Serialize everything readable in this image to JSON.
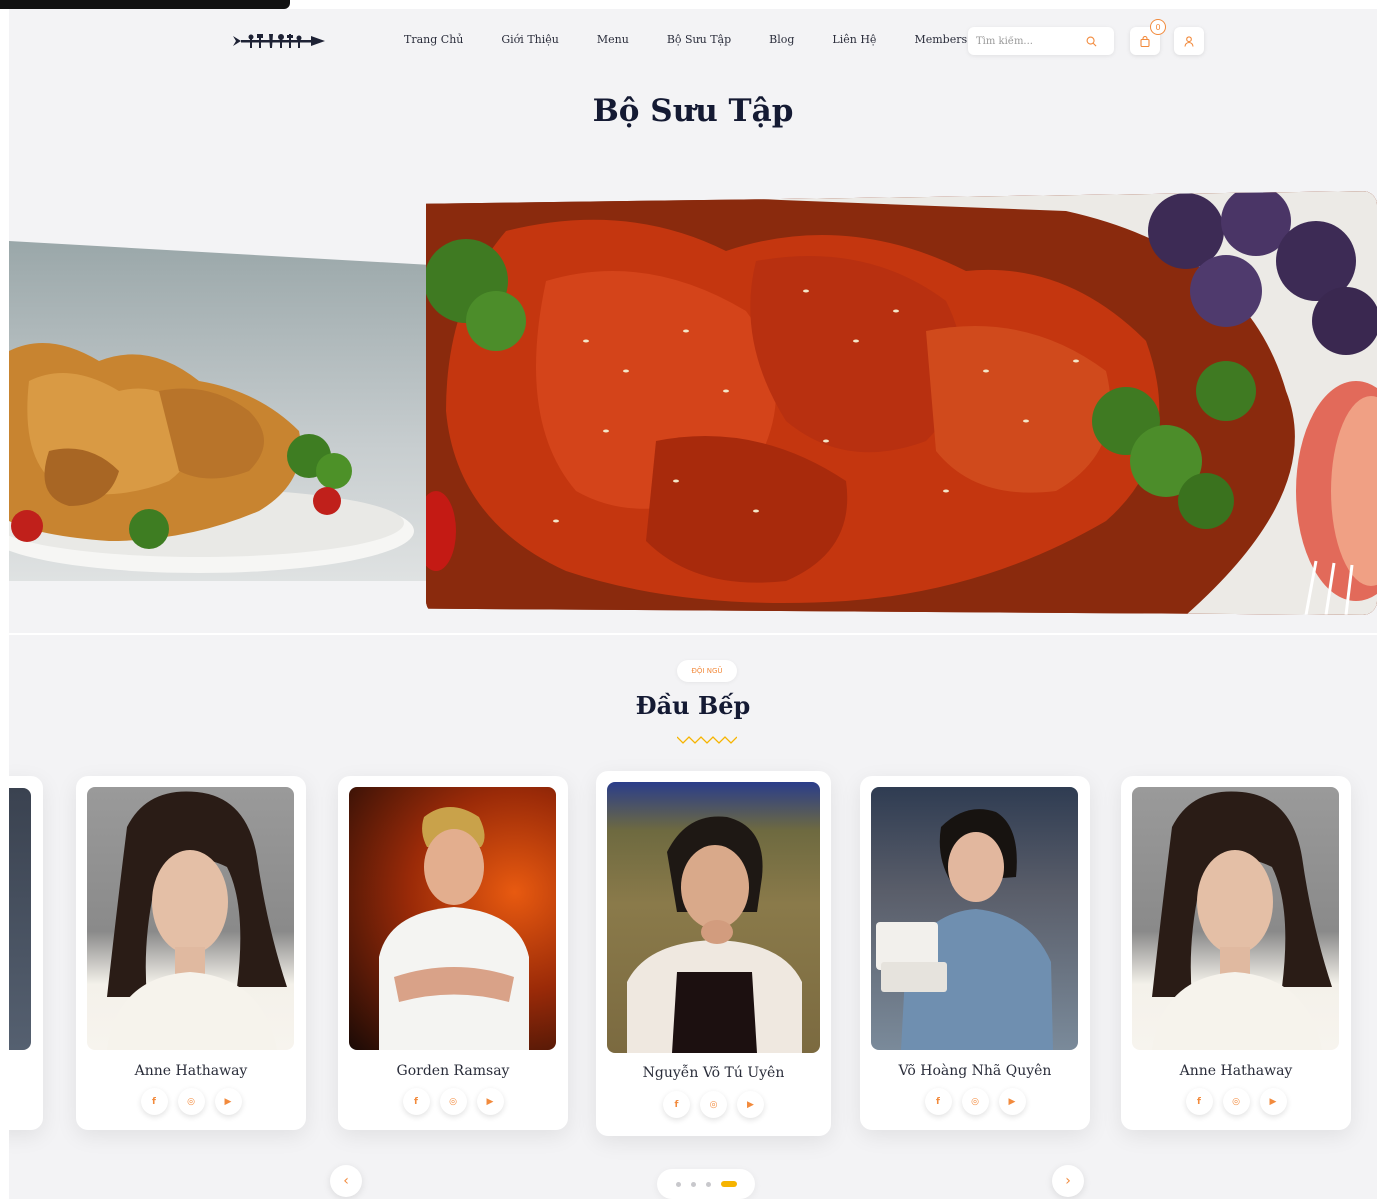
{
  "nav": {
    "items": [
      "Trang Chủ",
      "Giới Thiệu",
      "Menu",
      "Bộ Sưu Tập",
      "Blog",
      "Liên Hệ",
      "Members"
    ]
  },
  "search": {
    "placeholder": "Tìm kiếm..."
  },
  "cart": {
    "count": "0"
  },
  "page": {
    "title": "Bộ Sưu Tập"
  },
  "team": {
    "tag": "ĐỘI NGŨ",
    "title": "Đầu Bếp",
    "members": [
      {
        "name": "Anne Hathaway"
      },
      {
        "name": "Gorden Ramsay"
      },
      {
        "name": "Nguyễn Võ Tú Uyên"
      },
      {
        "name": "Võ Hoàng Nhã Quyên"
      },
      {
        "name": "Anne Hathaway"
      }
    ]
  },
  "social": {
    "facebook": "f",
    "instagram": "◎",
    "youtube": "▶"
  },
  "slider": {
    "prev": "‹",
    "next": "›"
  },
  "colors": {
    "accent": "#f28a3c",
    "title": "#141a33",
    "dot_active": "#f6b400"
  }
}
